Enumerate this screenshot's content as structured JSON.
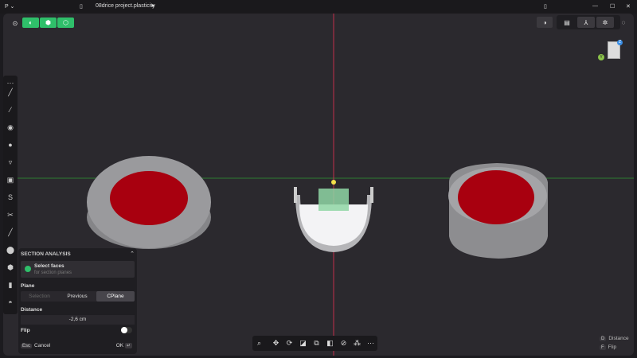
{
  "window": {
    "title": "08drice project.plasticity",
    "app_menu": "P ⌄"
  },
  "top_toolbar": {
    "left_icons": [
      "settings-icon",
      "face-select-icon",
      "solid-select-icon",
      "object-select-icon"
    ],
    "right_icons": [
      "xray-icon",
      "view-front-icon",
      "axes-icon",
      "render-mode-icon",
      "orbit-icon"
    ]
  },
  "gizmo": {
    "y_label": "Y",
    "z_label": "Z"
  },
  "left_toolbar": {
    "icons": [
      "grip-icon",
      "line-icon",
      "curve-icon",
      "circle-icon",
      "sphere-icon",
      "cylinder-cut-icon",
      "rectangle-icon",
      "spline-icon",
      "scissors-icon",
      "pen-icon",
      "solid-circle-icon",
      "box-icon",
      "cylinder-icon",
      "dome-icon"
    ]
  },
  "panel": {
    "title": "SECTION ANALYSIS",
    "select_label": "Select faces",
    "select_hint": "for section planes",
    "plane_label": "Plane",
    "plane_options": [
      "Selection",
      "Previous",
      "CPlane"
    ],
    "plane_selected": "CPlane",
    "distance_label": "Distance",
    "distance_value": "-2,6 cm",
    "flip_label": "Flip",
    "flip_on": false,
    "esc_key": "Esc",
    "cancel": "Cancel",
    "ok": "OK",
    "enter_key": "↵"
  },
  "bottom_toolbar": {
    "icons": [
      "search-icon",
      "move-icon",
      "rotate-icon",
      "scale-icon",
      "duplicate-icon",
      "boolean-icon",
      "link-icon",
      "mix-icon",
      "more-icon"
    ]
  },
  "shortcuts": [
    {
      "key": "D",
      "label": "Distance"
    },
    {
      "key": "F",
      "label": "Flip"
    }
  ],
  "colors": {
    "accent": "#2fbf6a",
    "section": "#a8000f",
    "x_axis": "#c0304a",
    "y_axis": "#2e7d32"
  }
}
